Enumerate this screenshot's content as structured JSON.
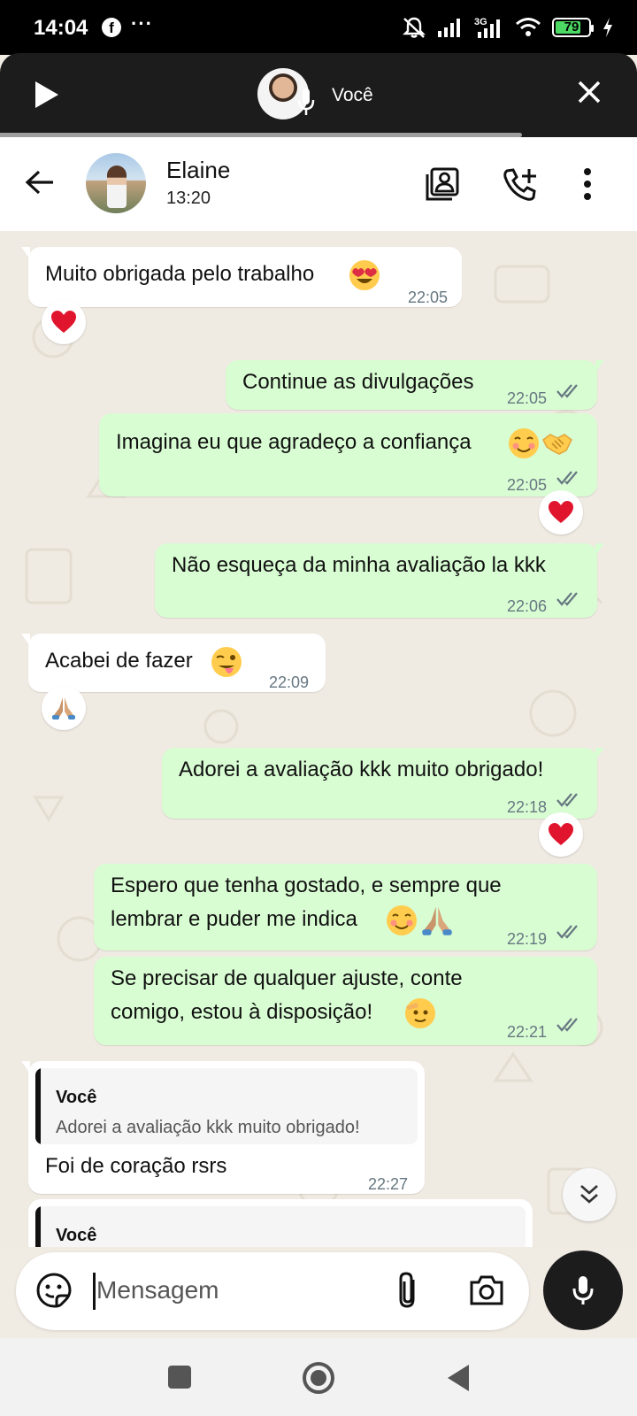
{
  "status_bar": {
    "time": "14:04",
    "app_icon": "facebook-icon",
    "more": "···",
    "network_label": "3G",
    "battery_percent": 79,
    "battery_label": "79",
    "icons": [
      "mute-bell-icon",
      "signal-icon",
      "signal-3g-icon",
      "wifi-icon",
      "battery-icon",
      "charging-bolt-icon"
    ]
  },
  "voice_banner": {
    "title": "Você",
    "play_icon": "play-icon",
    "mic_icon": "microphone-icon",
    "close_icon": "close-icon"
  },
  "header": {
    "contact_name": "Elaine",
    "subtitle": "13:20",
    "icons": [
      "back-arrow-icon",
      "contact-card-icon",
      "add-call-icon",
      "more-vert-icon"
    ]
  },
  "messages": [
    {
      "dir": "in",
      "text": "Muito obrigada pelo trabalho",
      "emojis": [
        "heart-eyes"
      ],
      "time": "22:05",
      "reaction": "heart"
    },
    {
      "dir": "out",
      "text": "Continue as divulgações",
      "time": "22:05",
      "read": true
    },
    {
      "dir": "out",
      "text": "Imagina eu que agradeço a confiança",
      "emojis": [
        "smiling-blush",
        "handshake"
      ],
      "time": "22:05",
      "read": true,
      "reaction": "heart"
    },
    {
      "dir": "out",
      "text": "Não esqueça da minha avaliação la kkk",
      "time": "22:06",
      "read": true
    },
    {
      "dir": "in",
      "text": "Acabei de fazer",
      "emojis": [
        "winking-tongue"
      ],
      "time": "22:09",
      "reaction": "folded-hands"
    },
    {
      "dir": "out",
      "text": "Adorei a avaliação kkk muito obrigado!",
      "time": "22:18",
      "read": true,
      "reaction": "heart"
    },
    {
      "dir": "out",
      "lines": [
        "Espero que tenha gostado, e sempre que",
        "lembrar e puder me indica"
      ],
      "emojis": [
        "smiling-blush",
        "folded-hands"
      ],
      "time": "22:19",
      "read": true
    },
    {
      "dir": "out",
      "lines": [
        "Se precisar de qualquer ajuste, conte",
        "comigo, estou à disposição!"
      ],
      "emojis": [
        "saluting-face"
      ],
      "time": "22:21",
      "read": true
    },
    {
      "dir": "in",
      "quote_author": "Você",
      "quote_text": "Adorei a avaliação kkk muito obrigado!",
      "text": "Foi de coração rsrs",
      "time": "22:27"
    },
    {
      "dir": "in",
      "quote_author": "Você",
      "partial": true
    }
  ],
  "composer": {
    "placeholder": "Mensagem",
    "icons": [
      "sticker-icon",
      "attach-icon",
      "camera-icon",
      "microphone-icon"
    ]
  },
  "colors": {
    "outgoing_bubble": "#d9fdd3",
    "incoming_bubble": "#ffffff",
    "chat_background": "#efeae2",
    "read_ticks": "#667781",
    "header_bar": "#1c1c1c"
  }
}
